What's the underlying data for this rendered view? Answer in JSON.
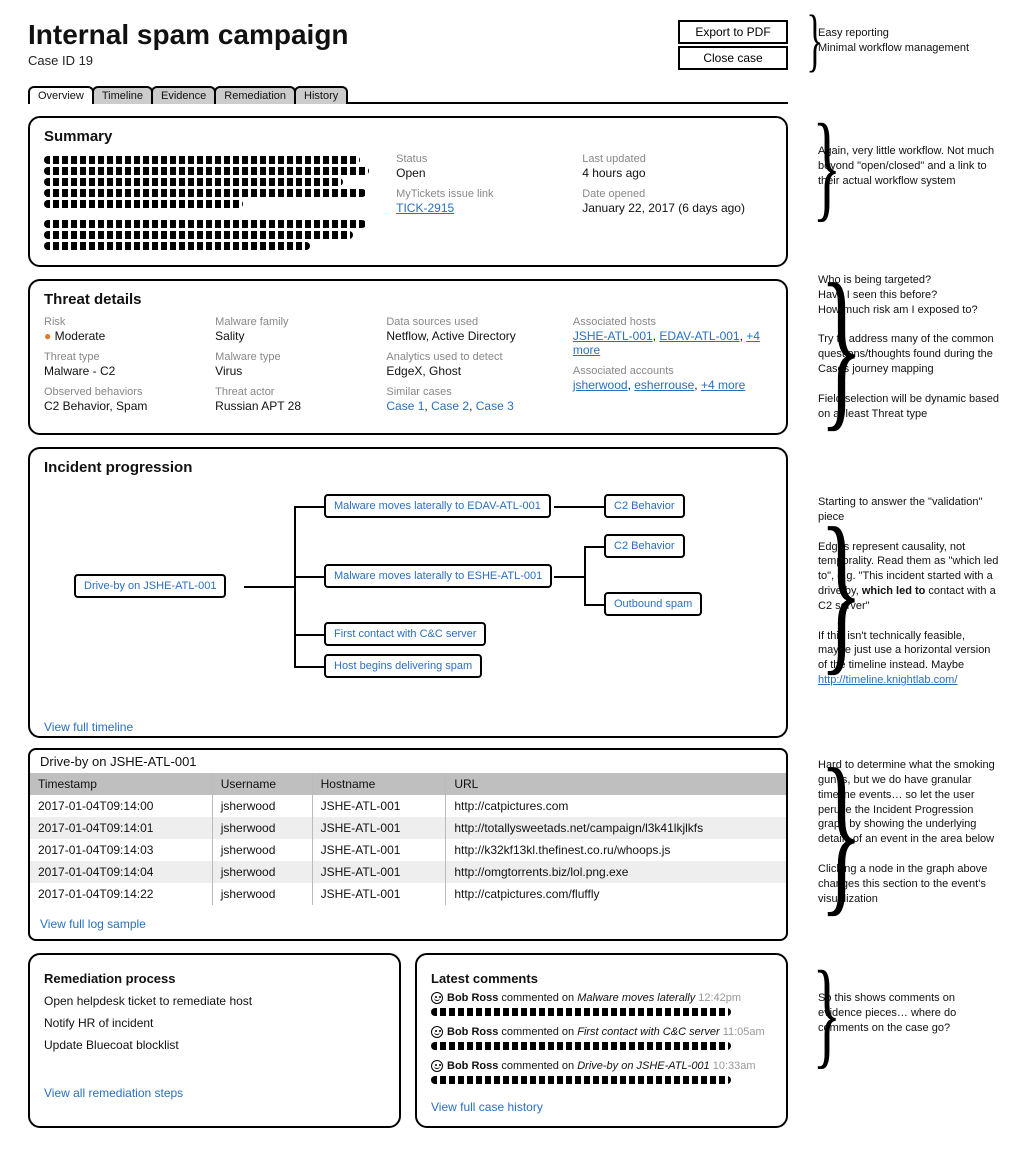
{
  "header": {
    "title": "Internal spam campaign",
    "case_id": "Case ID 19",
    "export_btn": "Export to PDF",
    "close_btn": "Close case"
  },
  "tabs": [
    "Overview",
    "Timeline",
    "Evidence",
    "Remediation",
    "History"
  ],
  "summary": {
    "heading": "Summary",
    "status_label": "Status",
    "status": "Open",
    "updated_label": "Last updated",
    "updated": "4 hours ago",
    "ticket_label": "MyTickets issue link",
    "ticket": "TICK-2915",
    "opened_label": "Date opened",
    "opened": "January 22, 2017 (6 days ago)"
  },
  "threat": {
    "heading": "Threat details",
    "risk_label": "Risk",
    "risk": "Moderate",
    "type_label": "Threat type",
    "type": "Malware - C2",
    "behaviors_label": "Observed behaviors",
    "behaviors": "C2 Behavior, Spam",
    "family_label": "Malware family",
    "family": "Sality",
    "mtype_label": "Malware type",
    "mtype": "Virus",
    "actor_label": "Threat actor",
    "actor": "Russian APT 28",
    "sources_label": "Data sources used",
    "sources": "Netflow, Active Directory",
    "analytics_label": "Analytics used to detect",
    "analytics": "EdgeX, Ghost",
    "similar_label": "Similar cases",
    "similar": {
      "c1": "Case 1",
      "c2": "Case 2",
      "c3": "Case 3",
      "sep": ", "
    },
    "hosts_label": "Associated hosts",
    "hosts": {
      "h1": "JSHE-ATL-001",
      "h2": "EDAV-ATL-001",
      "more": "+4 more",
      "sep": ", "
    },
    "accts_label": "Associated accounts",
    "accts": {
      "a1": "jsherwood",
      "a2": "esherrouse",
      "more": "+4 more",
      "sep": ", "
    }
  },
  "incident": {
    "heading": "Incident progression",
    "view_timeline": "View full timeline",
    "nodes": {
      "root": "Drive-by on JSHE-ATL-001",
      "n1": "Malware moves laterally to EDAV-ATL-001",
      "n2": "Malware moves laterally to ESHE-ATL-001",
      "n3": "First contact with C&C server",
      "n4": "Host begins delivering spam",
      "leaf1": "C2 Behavior",
      "leaf2": "C2 Behavior",
      "leaf3": "Outbound spam"
    }
  },
  "timeline": {
    "title": "Drive-by on JSHE-ATL-001",
    "columns": [
      "Timestamp",
      "Username",
      "Hostname",
      "URL"
    ],
    "rows": [
      {
        "c0": "2017-01-04T09:14:00",
        "c1": "jsherwood",
        "c2": "JSHE-ATL-001",
        "c3": "http://catpictures.com"
      },
      {
        "c0": "2017-01-04T09:14:01",
        "c1": "jsherwood",
        "c2": "JSHE-ATL-001",
        "c3": "http://totallysweetads.net/campaign/l3k41lkjlkfs"
      },
      {
        "c0": "2017-01-04T09:14:03",
        "c1": "jsherwood",
        "c2": "JSHE-ATL-001",
        "c3": "http://k32kf13kl.thefinest.co.ru/whoops.js"
      },
      {
        "c0": "2017-01-04T09:14:04",
        "c1": "jsherwood",
        "c2": "JSHE-ATL-001",
        "c3": "http://omgtorrents.biz/lol.png.exe"
      },
      {
        "c0": "2017-01-04T09:14:22",
        "c1": "jsherwood",
        "c2": "JSHE-ATL-001",
        "c3": "http://catpictures.com/fluffly"
      }
    ],
    "view_log": "View full log sample"
  },
  "remediation": {
    "heading": "Remediation process",
    "steps": [
      "Open helpdesk ticket to remediate host",
      "Notify HR of incident",
      "Update Bluecoat blocklist"
    ],
    "view_all": "View all remediation steps"
  },
  "comments": {
    "heading": "Latest comments",
    "items": [
      {
        "who": "Bob Ross",
        "verb": " commented on ",
        "what": "Malware moves laterally",
        "when": " 12:42pm"
      },
      {
        "who": "Bob Ross",
        "verb": " commented on ",
        "what": "First contact with C&C server",
        "when": " 11:05am"
      },
      {
        "who": "Bob Ross",
        "verb": " commented on ",
        "what": "Drive-by on JSHE-ATL-001",
        "when": " 10:33am"
      }
    ],
    "view_all": "View full case history"
  },
  "annotations": {
    "top": "Easy reporting\nMinimal workflow management",
    "summary": "Again, very little workflow. Not much beyond \"open/closed\" and a link to their actual workflow system",
    "threat": "Who is being targeted?\nHave I seen this before?\nHow much risk am I exposed to?\n\nTry to address many of the common questions/thoughts found during the Cases journey mapping\n\nField selection will be dynamic based on at least Threat type",
    "incident_a": "Starting to answer the \"validation\" piece\n\nEdges represent causality, not temporality. Read them as \"which led to\", e.g. \"This incident started with a drive by, ",
    "incident_bold": "which led to",
    "incident_b": " contact with a C2 server\"\n\nIf this isn't technically feasible, maybe just use a horizontal version of the timeline instead. Maybe ",
    "incident_link": "http://timeline.knightlab.com/",
    "table": "Hard to determine what the smoking gun is, but we do have granular timeline events… so let the user peruse the Incident Progression graph by showing the underlying details of an event in the area below\n\nClicking a node in the graph above changes this section to the event's visualization",
    "comments": "So this shows comments on evidence pieces… where do comments on the case go?"
  }
}
